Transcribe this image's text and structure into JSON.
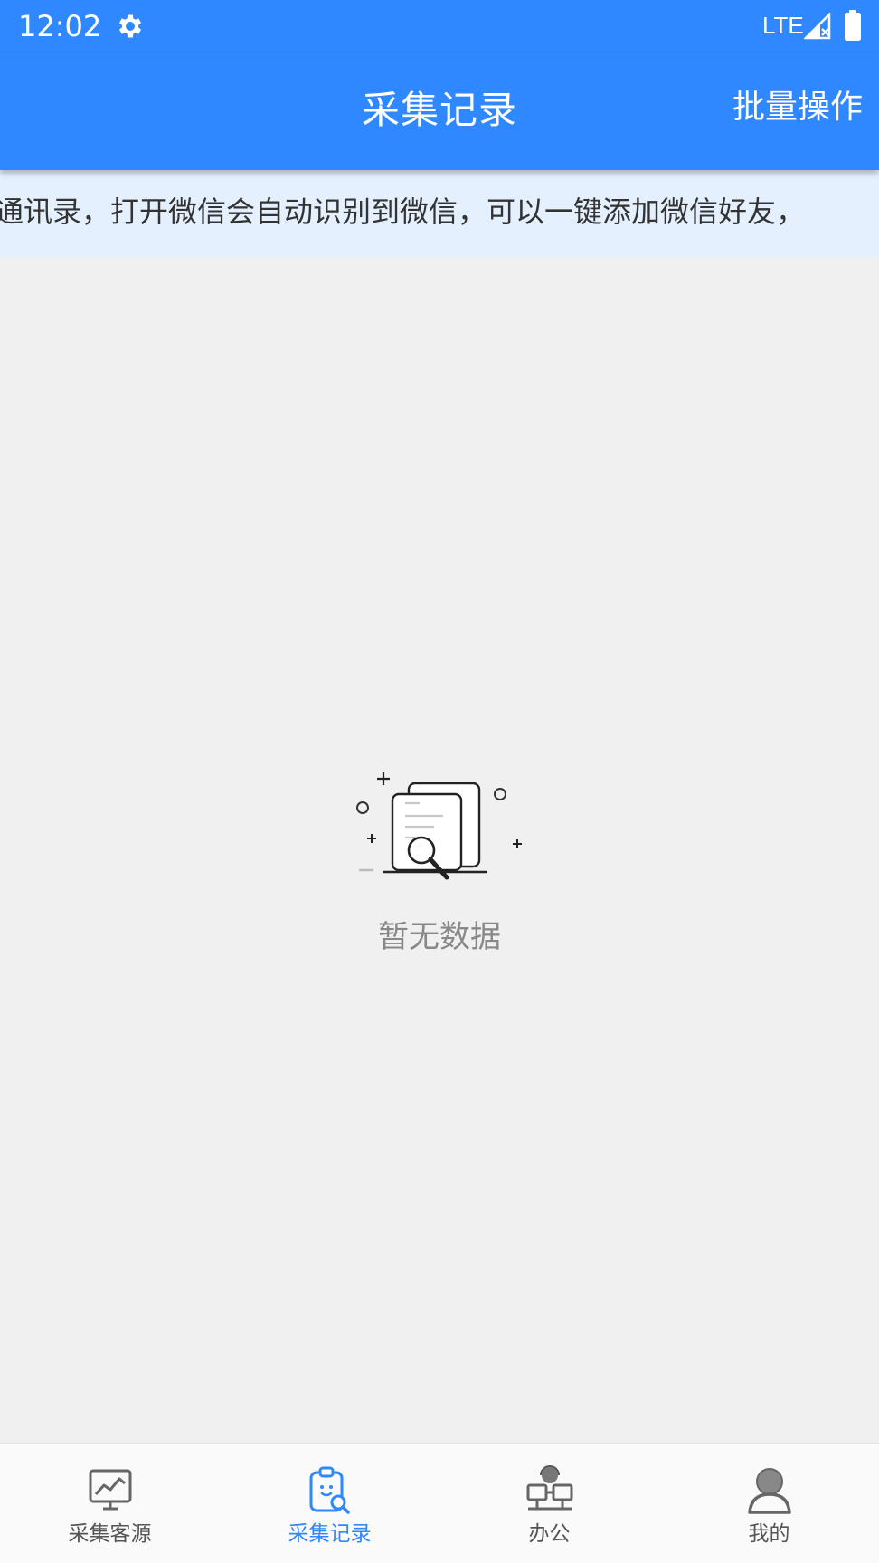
{
  "status_bar": {
    "time": "12:02",
    "network": "LTE",
    "icons": [
      "gear-icon",
      "signal-icon",
      "battery-icon"
    ]
  },
  "app_bar": {
    "title": "采集记录",
    "batch_label": "批量操作"
  },
  "notice": {
    "text": "通讯录，打开微信会自动识别到微信，可以一键添加微信好友，"
  },
  "empty_state": {
    "icon": "empty-document-search-icon",
    "text": "暂无数据"
  },
  "bottom_nav": {
    "items": [
      {
        "label": "采集客源",
        "icon": "chart-monitor-icon",
        "active": false
      },
      {
        "label": "采集记录",
        "icon": "clipboard-search-icon",
        "active": true
      },
      {
        "label": "办公",
        "icon": "office-network-icon",
        "active": false
      },
      {
        "label": "我的",
        "icon": "user-icon",
        "active": false
      }
    ]
  },
  "colors": {
    "primary": "#2f88ff",
    "notice_bg": "#e5f0ff",
    "page_bg": "#f0f0f0",
    "nav_inactive": "#555555"
  }
}
